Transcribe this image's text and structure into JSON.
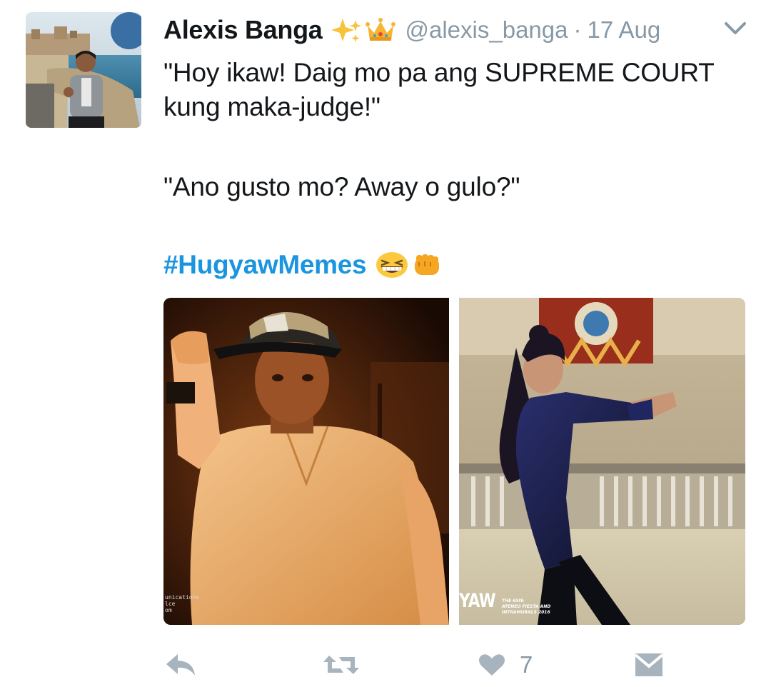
{
  "tweet": {
    "author": {
      "display_name": "Alexis Banga",
      "badges": [
        "sparkles-emoji",
        "crown-emoji"
      ],
      "handle": "@alexis_banga",
      "separator": "·",
      "timestamp": "17 Aug"
    },
    "text": {
      "line1": "\"Hoy ikaw! Daig mo pa ang SUPREME COURT kung maka-judge!\"",
      "line2": "\"Ano gusto mo? Away o gulo?\""
    },
    "hashtag": "#HugyawMemes",
    "hashtag_emojis": [
      "grinning-squinting-face-emoji",
      "oncoming-fist-emoji"
    ],
    "media": {
      "left": {
        "description_icon": "photo",
        "watermark": "unications\nlce\nom"
      },
      "right": {
        "description_icon": "photo",
        "logo_text": "YAW",
        "logo_subtext": "THE 65th\nATENEO FIESTA AND\nINTRAMURALS 2016"
      }
    },
    "actions": {
      "reply_icon": "reply-icon",
      "retweet_icon": "retweet-icon",
      "like_icon": "heart-icon",
      "like_count": "7",
      "dm_icon": "direct-message-icon"
    }
  },
  "colors": {
    "link": "#1b95e0",
    "muted": "#8899a6",
    "text": "#14171a"
  }
}
